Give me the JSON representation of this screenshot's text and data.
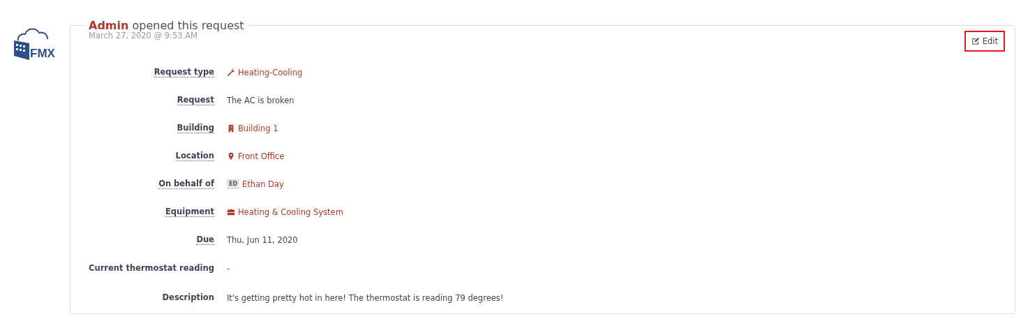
{
  "logo": {
    "text": "FMX"
  },
  "card": {
    "title": "**Admin** opened this request",
    "timestamp": "March 27, 2020 @ 9:53 AM",
    "edit": {
      "label": "Edit",
      "highlighted": true
    }
  },
  "fields": [
    {
      "label": "Request type",
      "underlined": true,
      "kind": "tool",
      "value": "Heating-Cooling"
    },
    {
      "label": "Request",
      "underlined": true,
      "kind": "text",
      "value": "The AC is broken"
    },
    {
      "label": "Building",
      "underlined": true,
      "kind": "building",
      "value": "Building 1"
    },
    {
      "label": "Location",
      "underlined": true,
      "kind": "place",
      "value": "Front Office"
    },
    {
      "label": "On behalf of",
      "underlined": true,
      "kind": "person",
      "initials": "ED",
      "value": "Ethan Day"
    },
    {
      "label": "Equipment",
      "underlined": true,
      "kind": "equipment",
      "value": "Heating & Cooling System"
    },
    {
      "label": "Due",
      "underlined": true,
      "kind": "text",
      "value": "Thu, Jun 11, 2020"
    },
    {
      "label": "Current thermostat reading",
      "underlined": false,
      "kind": "text",
      "value": "-"
    },
    {
      "label": "Description",
      "underlined": false,
      "kind": "text",
      "value": "It's getting pretty hot in here! The thermostat is reading 79 degrees!"
    }
  ]
}
